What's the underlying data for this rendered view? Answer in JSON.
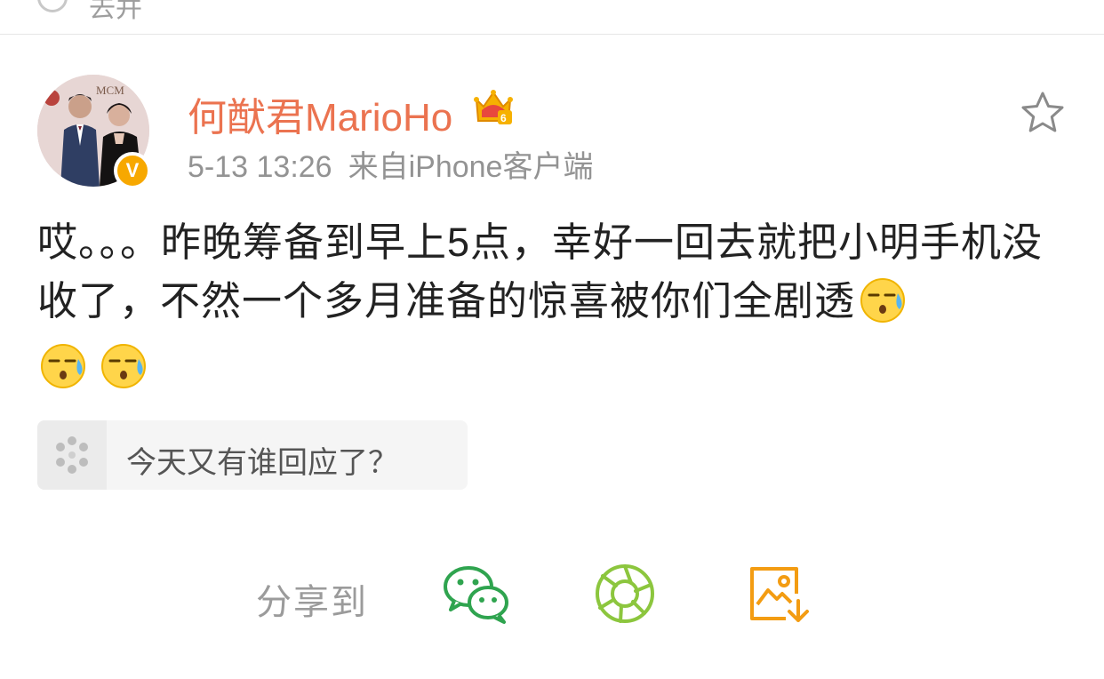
{
  "top_strip": {
    "text": "去并"
  },
  "post": {
    "username": "何猷君MarioHo",
    "avatar_banner": "MCM",
    "verified_mark": "V",
    "member_level": "6",
    "time": "5-13 13:26",
    "source": "来自iPhone客户端",
    "text": "哎。。。昨晚筹备到早上5点，幸好一回去就把小明手机没收了，不然一个多月准备的惊喜被你们全剧透",
    "emojis": [
      "sweat-emoji",
      "sweat-emoji",
      "sweat-emoji"
    ]
  },
  "topic_card": {
    "text": "今天又有谁回应了？"
  },
  "share": {
    "label": "分享到",
    "targets": [
      {
        "name": "wechat",
        "icon": "wechat-icon",
        "color": "#2fa44f"
      },
      {
        "name": "moments",
        "icon": "moments-icon",
        "color": "#8cc63e"
      },
      {
        "name": "save-image",
        "icon": "save-image-icon",
        "color": "#f39c12"
      }
    ]
  },
  "colors": {
    "username": "#eb7350",
    "meta": "#939393",
    "body_text": "#222222",
    "verified": "#f7a800"
  }
}
